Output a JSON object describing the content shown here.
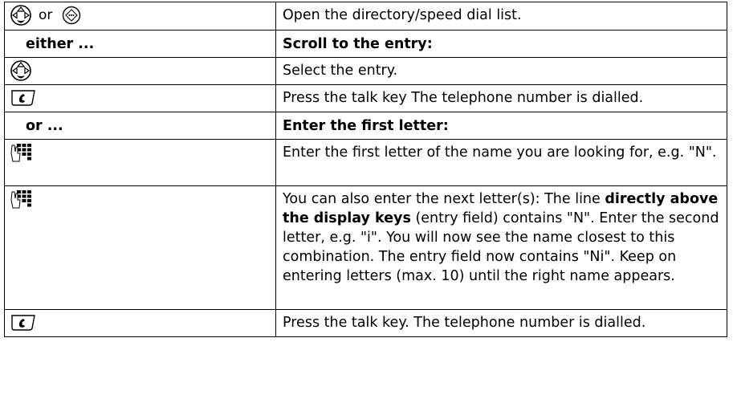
{
  "rows": [
    {
      "left_or": "or",
      "left_icons": [
        "navigation-key-icon",
        "menu-key-icon"
      ],
      "right": "Open the directory/speed dial list."
    },
    {
      "header_left": "either ...",
      "header_right": "Scroll to the entry:"
    },
    {
      "left_icons": [
        "navigation-key-icon"
      ],
      "right": "Select the entry."
    },
    {
      "left_icons": [
        "talk-key-icon"
      ],
      "right": "Press the talk key The telephone number is dialled."
    },
    {
      "header_left": "or ...",
      "header_right": "Enter the first letter:"
    },
    {
      "left_icons": [
        "keypad-icon"
      ],
      "right": "Enter the first letter of the name you are looking for, e.g. \"N\"."
    },
    {
      "left_icons": [
        "keypad-icon"
      ],
      "right_pre": "You can also enter the next letter(s): The line ",
      "right_bold": "directly above the display keys",
      "right_post": " (entry field) contains \"N\". Enter the second letter, e.g. \"i\". You will now see the name closest to this combination. The entry field now contains \"Ni\". Keep on entering letters (max. 10) until the right name appears."
    },
    {
      "left_icons": [
        "talk-key-icon"
      ],
      "right": "Press the talk key. The telephone number is dialled."
    }
  ]
}
